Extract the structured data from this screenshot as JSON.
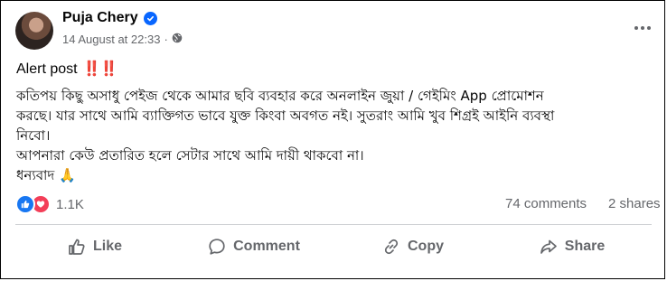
{
  "post": {
    "author": "Puja Chery",
    "timestamp": "14 August at 22:33",
    "separator": "·",
    "audience_icon": "globe-icon",
    "verified_icon": "verified-badge-icon",
    "more_icon": "more-options-icon",
    "alert_text": "Alert post",
    "alert_emoji": "‼️‼️",
    "body_lines": [
      "কতিপয় কিছু অসাধু পেইজ থেকে আমার ছবি ব্যবহার করে অনলাইন জুয়া / গেইমিং App প্রোমোশন",
      "করছে। যার সাথে আমি ব্যাক্তিগত ভাবে যুক্ত কিংবা অবগত নই। সুতরাং আমি খুব  শিগ্রই  আইনি ব্যবস্থা",
      "নিবো।",
      "আপনারা কেউ প্রতারিত হলে সেটার সাথে আমি দায়ী থাকবো না।",
      "ধন্যবাদ 🙏"
    ]
  },
  "stats": {
    "reaction_count": "1.1K",
    "comments": "74 comments",
    "shares": "2 shares"
  },
  "actions": {
    "like": "Like",
    "comment": "Comment",
    "copy": "Copy",
    "share": "Share"
  },
  "colors": {
    "primary_text": "#050505",
    "secondary_text": "#65676b",
    "facebook_blue": "#1877f2",
    "love_red": "#f33e58",
    "divider": "#ced0d4"
  }
}
